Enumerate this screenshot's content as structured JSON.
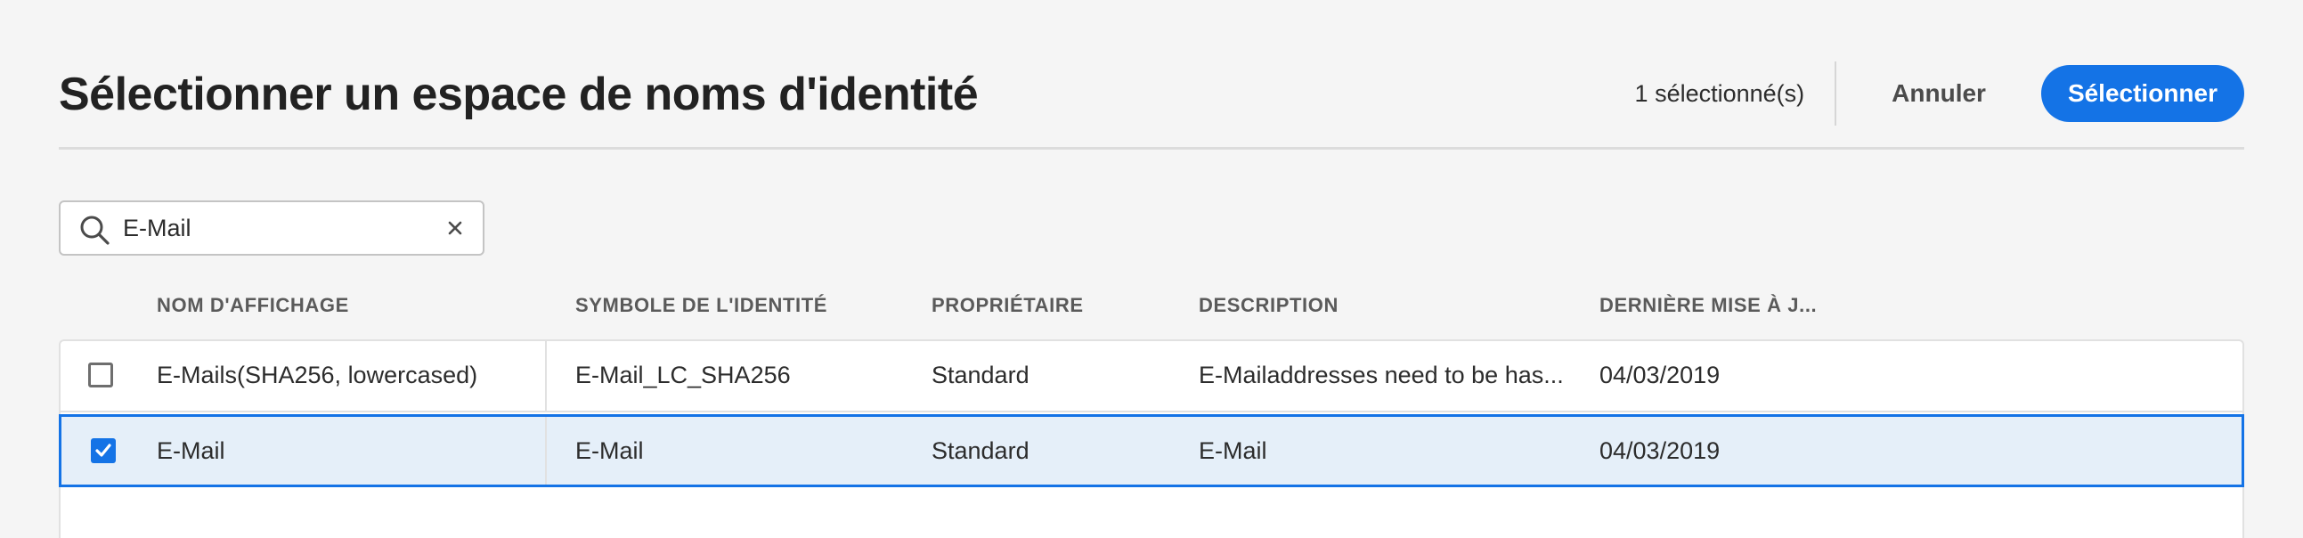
{
  "dialog": {
    "title": "Sélectionner un espace de noms d'identité",
    "selected_count": "1 sélectionné(s)",
    "cancel_label": "Annuler",
    "select_label": "Sélectionner"
  },
  "search": {
    "value": "E-Mail",
    "icon": "search-icon",
    "clear_icon": "close-icon"
  },
  "table": {
    "columns": [
      "NOM D'AFFICHAGE",
      "SYMBOLE DE L'IDENTITÉ",
      "PROPRIÉTAIRE",
      "DESCRIPTION",
      "DERNIÈRE MISE À J..."
    ],
    "rows": [
      {
        "checked": false,
        "display_name": "E-Mails(SHA256, lowercased)",
        "symbol": "E-Mail_LC_SHA256",
        "owner": "Standard",
        "description": "E-Mailaddresses need to be has...",
        "last_updated": "04/03/2019"
      },
      {
        "checked": true,
        "display_name": "E-Mail",
        "symbol": "E-Mail",
        "owner": "Standard",
        "description": "E-Mail",
        "last_updated": "04/03/2019"
      }
    ]
  },
  "colors": {
    "accent": "#1473e6",
    "selected_row_bg": "#e5eff9",
    "background": "#f5f5f5"
  }
}
